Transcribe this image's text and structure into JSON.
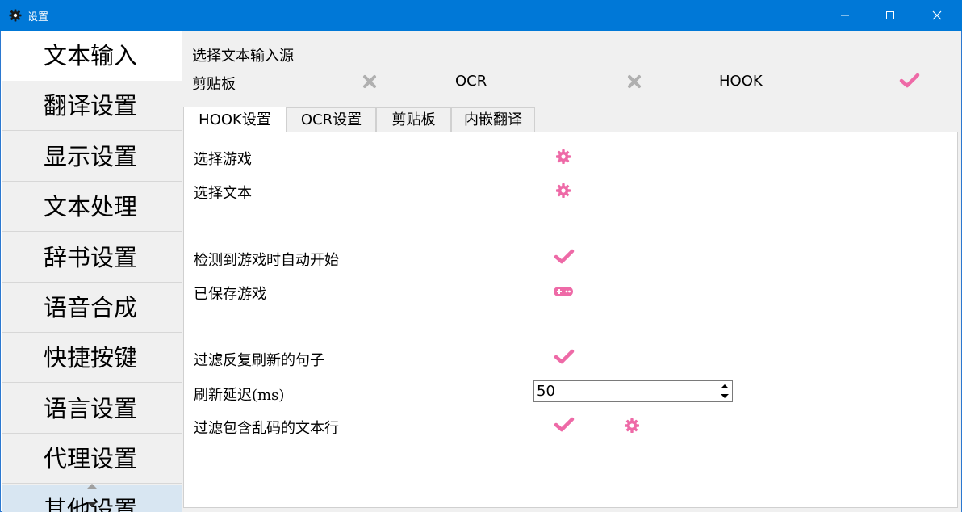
{
  "window": {
    "title": "设置"
  },
  "sidebar": {
    "items": [
      {
        "label": "文本输入"
      },
      {
        "label": "翻译设置"
      },
      {
        "label": "显示设置"
      },
      {
        "label": "文本处理"
      },
      {
        "label": "辞书设置"
      },
      {
        "label": "语音合成"
      },
      {
        "label": "快捷按键"
      },
      {
        "label": "语言设置"
      },
      {
        "label": "代理设置"
      },
      {
        "label": "其他设置"
      }
    ]
  },
  "source": {
    "title": "选择文本输入源",
    "options": [
      {
        "label": "剪贴板",
        "state": "off"
      },
      {
        "label": "OCR",
        "state": "off"
      },
      {
        "label": "HOOK",
        "state": "on"
      }
    ]
  },
  "tabs": [
    {
      "label": "HOOK设置"
    },
    {
      "label": "OCR设置"
    },
    {
      "label": "剪贴板"
    },
    {
      "label": "内嵌翻译"
    }
  ],
  "hook": {
    "select_game": "选择游戏",
    "select_text": "选择文本",
    "auto_start": "检测到游戏时自动开始",
    "saved_games": "已保存游戏",
    "filter_repeat": "过滤反复刷新的句子",
    "refresh_delay_label": "刷新延迟(ms)",
    "refresh_delay_value": "50",
    "filter_garbled": "过滤包含乱码的文本行"
  },
  "colors": {
    "accent": "#ee6aa7",
    "titlebar": "#0078d7",
    "off": "#b0b0b0"
  }
}
